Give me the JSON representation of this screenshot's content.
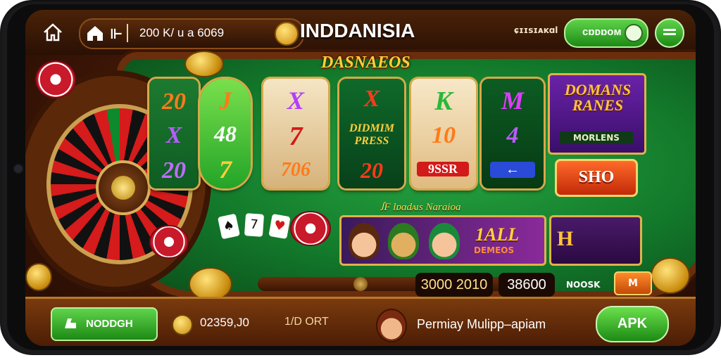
{
  "topbar": {
    "fav_symbol": "⊩",
    "balance": "200 K/ u a 6069",
    "app_title": "INDDANISIA",
    "top_label": "ɕɪɪsɪᴀᴋɑl",
    "green_pill": "ᴄɒᴅɒᴏᴍ"
  },
  "brand_header": "DASNAEOS",
  "reels": {
    "r1": [
      "20",
      "X",
      "20"
    ],
    "r2": [
      "J",
      "48",
      "7"
    ],
    "r3": [
      "X",
      "7",
      "706"
    ],
    "r4": [
      "X",
      "DIDMIM PRESS",
      "20"
    ],
    "r5": [
      "K",
      "10",
      "9SSR"
    ],
    "r6": [
      "M",
      "4",
      "←"
    ]
  },
  "promo": {
    "title": "DOMANS RANES",
    "sub": "MORLENS"
  },
  "stop_button": "SHO",
  "section_label": "ꭍF lɒɑdᴀɪs Naraioa",
  "cards": [
    "♠",
    "7",
    "♥"
  ],
  "game_banner": {
    "big": "1ALL",
    "sub": "DEMEOS"
  },
  "game_banner2": {
    "big": "H"
  },
  "controls": {
    "value1": "3000 2010",
    "value2": "38600",
    "label": "NOOSK",
    "m_button": "M"
  },
  "bottombar": {
    "green_button": "NODDGH",
    "coin_amount": "02359,J0",
    "label": "1/D ORT",
    "promo_text": "Permiay Mulipp–apiam",
    "apk_button": "APK"
  },
  "colors": {
    "felt": "#1a8a34",
    "wood": "#6a2e0d",
    "gold": "#e0b24a",
    "green_button": "#2fa82a"
  }
}
